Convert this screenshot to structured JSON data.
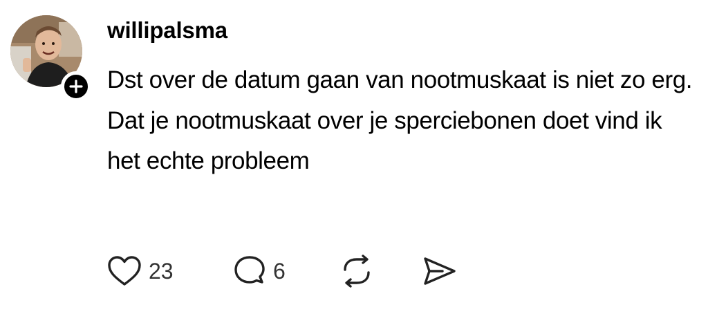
{
  "post": {
    "username": "willipalsma",
    "text": "Dst over de datum gaan van nootmuskaat is niet zo erg. Dat je nootmuskaat over je sperciebonen doet vind ik het echte probleem",
    "avatar_icon": "profile-photo",
    "follow_icon": "plus-icon"
  },
  "actions": {
    "like": {
      "icon": "heart-icon",
      "count": "23"
    },
    "reply": {
      "icon": "comment-icon",
      "count": "6"
    },
    "repost": {
      "icon": "repost-icon"
    },
    "share": {
      "icon": "send-icon"
    }
  },
  "colors": {
    "text": "#000000",
    "count": "#333333",
    "background": "#ffffff"
  }
}
